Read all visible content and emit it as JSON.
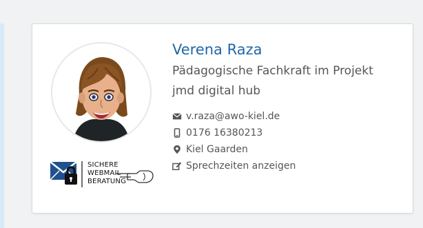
{
  "profile": {
    "name": "Verena Raza",
    "role_line1": "Pädagogische Fachkraft im Projekt",
    "role_line2": "jmd digital hub"
  },
  "contact": {
    "email": "v.raza@awo-kiel.de",
    "phone": "0176 16380213",
    "location": "Kiel Gaarden",
    "hours_link": "Sprechzeiten anzeigen"
  },
  "webmail": {
    "line1": "SICHERE",
    "line2": "WEBMAIL",
    "line3": "BERATUNG"
  },
  "icons": {
    "email": "envelope-icon",
    "phone": "mobile-phone-icon",
    "location": "map-pin-icon",
    "hours": "edit-icon",
    "webmail_logo": "secure-mail-icon",
    "pointer": "pointing-hand-icon"
  },
  "colors": {
    "name": "#1f67a8",
    "text": "#555555",
    "accent": "#2b4f86"
  }
}
